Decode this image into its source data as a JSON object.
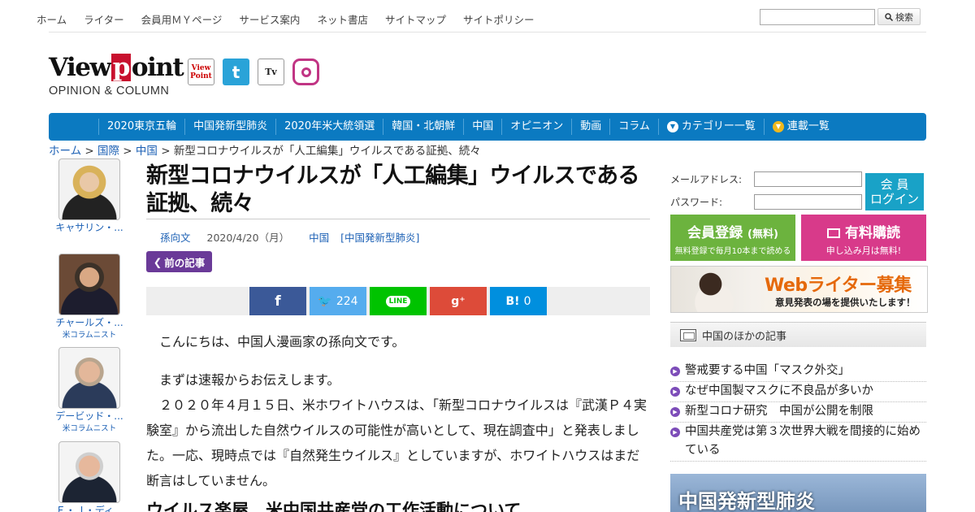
{
  "topnav": {
    "links": [
      "ホーム",
      "ライター",
      "会員用ＭＹページ",
      "サービス案内",
      "ネット書店",
      "サイトマップ",
      "サイトポリシー"
    ],
    "search_button": "検索"
  },
  "logo": {
    "main_left": "View",
    "main_p": "p",
    "main_right": "oint",
    "sub": "OPINION & COLUMN"
  },
  "social_icons": [
    "viewpoint-icon",
    "twitter-icon",
    "tv-icon",
    "instagram-icon"
  ],
  "categories": [
    "2020東京五輪",
    "中国発新型肺炎",
    "2020年米大統領選",
    "韓国・北朝鮮",
    "中国",
    "オピニオン",
    "動画",
    "コラム",
    "カテゴリー一覧",
    "連載一覧"
  ],
  "breadcrumb": {
    "items": [
      "ホーム",
      "国際",
      "中国"
    ],
    "sep": " > ",
    "current": "新型コロナウイルスが「人工編集」ウイルスである証拠、続々"
  },
  "writers": [
    {
      "name": "キャサリン・...",
      "role": ""
    },
    {
      "name": "チャールズ・...",
      "role": "米コラムニスト"
    },
    {
      "name": "デービッド・...",
      "role": "米コラムニスト"
    },
    {
      "name": "Ｅ・Ｊ・ディ...",
      "role": ""
    }
  ],
  "article": {
    "title": "新型コロナウイルスが「人工編集」ウイルスである証拠、続々",
    "author": "孫向文",
    "date": "2020/4/20（月）",
    "category": "中国",
    "tag": "[中国発新型肺炎]",
    "prev_label": "前の記事",
    "share": {
      "twitter_count": "224",
      "hatena_count": "0"
    },
    "paragraphs": [
      "こんにちは、中国人漫画家の孫向文です。",
      "まずは速報からお伝えします。",
      "２０２０年４月１５日、米ホワイトハウスは、「新型コロナウイルスは『武漢Ｐ４実験室』から流出した自然ウイルスの可能性が高いとして、現在調査中」と発表しました。一応、現時点では『自然発生ウイルス』としていますが、ホワイトハウスはまだ断言はしていません。"
    ],
    "subhead": "ウイルス楽屋、米中国共産党の工作活動について"
  },
  "sidebar": {
    "email_label": "メールアドレス:",
    "password_label": "パスワード:",
    "login_button": [
      "会 員",
      "ログイン"
    ],
    "register": {
      "title": "会員登録",
      "title_sub": "(無料)",
      "note": "無料登録で毎月10本まで読める"
    },
    "purchase": {
      "title": "有料購読",
      "note": "申し込み月は無料!"
    },
    "banner": {
      "title": "Webライター募集",
      "sub": "意見発表の場を提供いたします！"
    },
    "related_heading": "中国のほかの記事",
    "related": [
      "警戒要する中国「マスク外交」",
      "なぜ中国製マスクに不良品が多いか",
      "新型コロナ研究　中国が公開を制限",
      "中国共産党は第３次世界大戦を間接的に始めている"
    ],
    "feature_title": "中国発新型肺炎"
  },
  "colors": {
    "nav_blue": "#0b7ac1",
    "prev_purple": "#6a3a98",
    "register_green": "#6cb33e",
    "purchase_pink": "#d83a8a",
    "login_cyan": "#19a2c7"
  }
}
